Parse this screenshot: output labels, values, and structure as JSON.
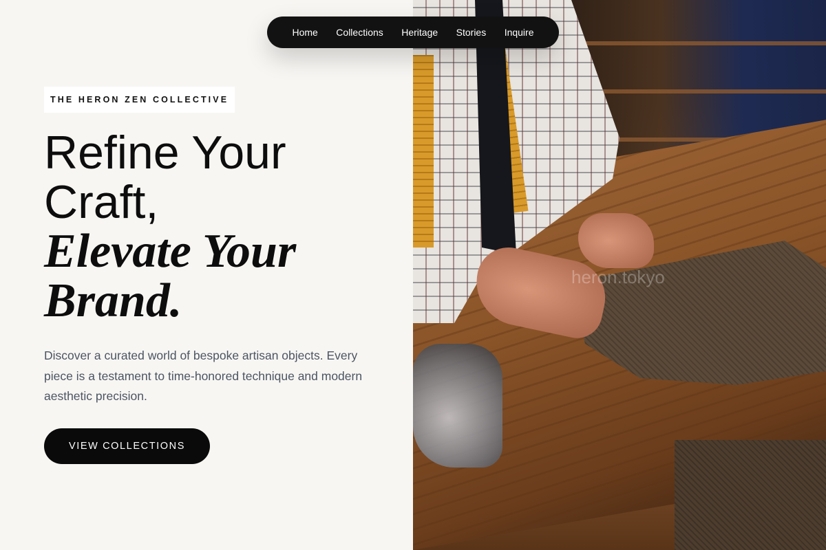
{
  "nav": {
    "items": [
      {
        "label": "Home"
      },
      {
        "label": "Collections"
      },
      {
        "label": "Heritage"
      },
      {
        "label": "Stories"
      },
      {
        "label": "Inquire"
      }
    ]
  },
  "hero": {
    "eyebrow": "THE HERON ZEN COLLECTIVE",
    "headline_line1": "Refine Your",
    "headline_line2": "Craft,",
    "headline_line3": "Elevate Your",
    "headline_line4": "Brand.",
    "description": "Discover a curated world of bespoke artisan objects. Every piece is a testament to time-honored technique and modern aesthetic precision.",
    "cta_label": "VIEW COLLECTIONS"
  },
  "image": {
    "subject": "tailor cutting tweed fabric on wooden workbench",
    "watermark": "heron.tokyo"
  },
  "colors": {
    "page_background": "#f8f6f3",
    "nav_background": "#121212",
    "cta_background": "#0a0a0a",
    "body_text": "#4b5563",
    "eyebrow_background": "#ffffff"
  }
}
